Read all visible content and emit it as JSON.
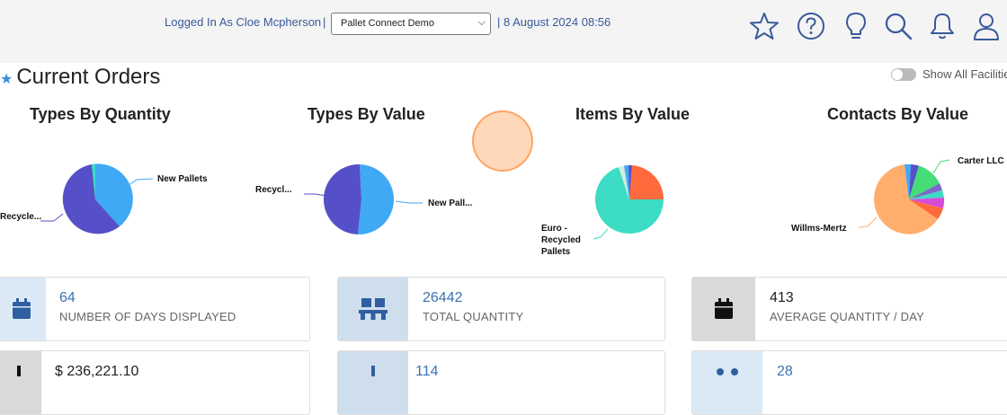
{
  "header": {
    "logged_in_text": "Logged In As Cloe Mcpherson",
    "separator": "|",
    "company_select": "Pallet Connect Demo",
    "datetime": "| 8 August 2024 08:56",
    "icons": [
      "star-icon",
      "help-icon",
      "lightbulb-icon",
      "search-icon",
      "bell-icon",
      "user-icon"
    ]
  },
  "page": {
    "title": "Current Orders",
    "toggle_label": "Show All Facilities",
    "toggle_on": false
  },
  "charts": [
    {
      "title": "Types By Quantity",
      "labels": [
        "New Pallets",
        "Recycle..."
      ]
    },
    {
      "title": "Types By Value",
      "labels": [
        "Recycl...",
        "New Pall..."
      ]
    },
    {
      "title": "Items By Value",
      "labels": [
        "Euro -\nRecycled\nPallets"
      ]
    },
    {
      "title": "Contacts By Value",
      "labels": [
        "Carter LLC",
        "Willms-Mertz"
      ]
    }
  ],
  "cards": [
    {
      "value": "64",
      "label": "Number of Days Displayed",
      "icon": "calendar-icon"
    },
    {
      "value": "26442",
      "label": "Total Quantity",
      "icon": "pallet-icon"
    },
    {
      "value": "413",
      "label": "Average Quantity / Day",
      "icon": "calendar-icon"
    },
    {
      "value": "$ 236,221.10",
      "label": "",
      "icon": "dollar-icon"
    },
    {
      "value": "114",
      "label": "",
      "icon": "chart-icon"
    },
    {
      "value": "28",
      "label": "",
      "icon": "users-icon"
    }
  ],
  "colors": {
    "accent_blue": "#3a5a9a",
    "value_blue": "#3a72b0",
    "pie_purple": "#5550c8",
    "pie_blue": "#3fa9f5",
    "pie_teal": "#3ddcc4",
    "pie_orange": "#ff6a3d",
    "pie_peach": "#ffae6e"
  }
}
